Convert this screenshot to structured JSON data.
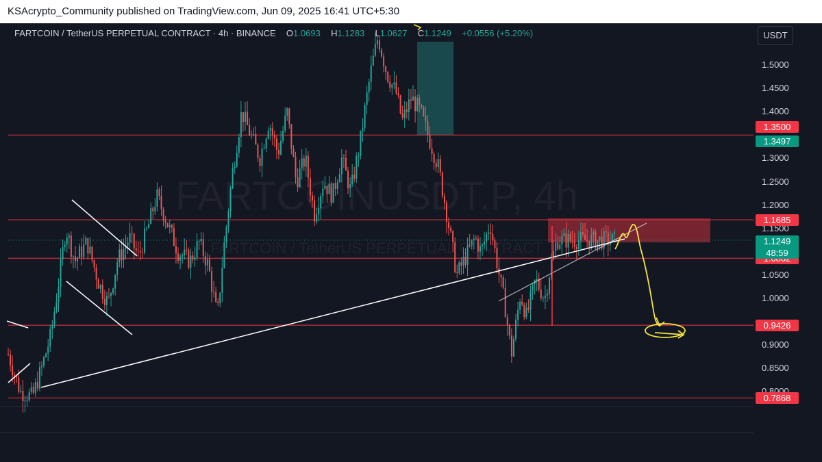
{
  "publisher_line": "KSAcrypto_Community published on TradingView.com, Jun 09, 2025 16:41 UTC+5:30",
  "header": {
    "symbol_line": "FARTCOIN / TetherUS PERPETUAL CONTRACT · 4h · BINANCE",
    "o_label": "O",
    "o_value": "1.0693",
    "h_label": "H",
    "h_value": "1.1283",
    "l_label": "L",
    "l_value": "1.0627",
    "c_label": "C",
    "c_value": "1.1249",
    "change": "+0.0556 (+5.20%)"
  },
  "currency_button": "USDT",
  "watermark": {
    "line1": "FARTCOINUSDT.P, 4h",
    "line2": "FARTCOIN / TetherUS PERPETUAL CONTRACT"
  },
  "colors": {
    "background": "#131722",
    "up": "#26a69a",
    "down": "#ef5350",
    "level_line": "#f23645",
    "badge_red": "#f23645",
    "badge_green": "#089981",
    "trendline": "#ffffff",
    "annotation": "#f5e642"
  },
  "chart_data": {
    "type": "candlestick",
    "timeframe": "4h",
    "y_axis_ticks": [
      "1.5000",
      "1.4500",
      "1.4000",
      "1.3000",
      "1.2500",
      "1.2000",
      "1.1500",
      "1.0500",
      "1.0000",
      "0.9000",
      "0.8500",
      "0.8000"
    ],
    "ylim": [
      0.77,
      1.55
    ],
    "horizontal_levels": [
      {
        "price": 1.3497,
        "label": "1.3497",
        "badge": "green"
      },
      {
        "price": 1.35,
        "label": "1.3500",
        "badge": "red"
      },
      {
        "price": 1.1685,
        "label": "1.1685",
        "badge": "red"
      },
      {
        "price": 1.0862,
        "label": "1.0862",
        "badge": "red"
      },
      {
        "price": 0.9426,
        "label": "0.9426",
        "badge": "red"
      },
      {
        "price": 0.7868,
        "label": "0.7868",
        "badge": "red"
      }
    ],
    "current_price": {
      "value": "1.1249",
      "countdown": "48:59"
    },
    "resistance_zone": {
      "from": 1.1685,
      "to": 1.12
    },
    "profit_zone": {
      "from": 1.35,
      "to": 1.55
    },
    "ohlc_last": {
      "open": 1.0693,
      "high": 1.1283,
      "low": 1.0627,
      "close": 1.1249,
      "change": 0.0556,
      "change_pct": 5.2
    },
    "close_path": [
      [
        0,
        0.88
      ],
      [
        0.02,
        0.8
      ],
      [
        0.04,
        0.79
      ],
      [
        0.055,
        0.85
      ],
      [
        0.07,
        0.92
      ],
      [
        0.085,
        1.05
      ],
      [
        0.095,
        1.15
      ],
      [
        0.11,
        1.08
      ],
      [
        0.13,
        1.12
      ],
      [
        0.15,
        1.03
      ],
      [
        0.165,
        0.99
      ],
      [
        0.18,
        1.08
      ],
      [
        0.2,
        1.13
      ],
      [
        0.215,
        1.09
      ],
      [
        0.23,
        1.15
      ],
      [
        0.245,
        1.22
      ],
      [
        0.26,
        1.17
      ],
      [
        0.28,
        1.1
      ],
      [
        0.3,
        1.08
      ],
      [
        0.315,
        1.12
      ],
      [
        0.33,
        1.07
      ],
      [
        0.345,
        0.96
      ],
      [
        0.355,
        1.1
      ],
      [
        0.37,
        1.27
      ],
      [
        0.385,
        1.4
      ],
      [
        0.4,
        1.35
      ],
      [
        0.415,
        1.3
      ],
      [
        0.43,
        1.38
      ],
      [
        0.445,
        1.31
      ],
      [
        0.46,
        1.4
      ],
      [
        0.475,
        1.25
      ],
      [
        0.49,
        1.3
      ],
      [
        0.505,
        1.18
      ],
      [
        0.52,
        1.25
      ],
      [
        0.535,
        1.22
      ],
      [
        0.55,
        1.3
      ],
      [
        0.565,
        1.23
      ],
      [
        0.58,
        1.33
      ],
      [
        0.59,
        1.42
      ],
      [
        0.6,
        1.5
      ],
      [
        0.61,
        1.56
      ],
      [
        0.625,
        1.48
      ],
      [
        0.64,
        1.44
      ],
      [
        0.65,
        1.38
      ],
      [
        0.665,
        1.43
      ],
      [
        0.68,
        1.4
      ],
      [
        0.695,
        1.34
      ],
      [
        0.71,
        1.28
      ],
      [
        0.725,
        1.17
      ],
      [
        0.74,
        1.05
      ],
      [
        0.755,
        1.09
      ],
      [
        0.77,
        1.13
      ],
      [
        0.78,
        1.1
      ],
      [
        0.795,
        1.16
      ],
      [
        0.81,
        1.05
      ],
      [
        0.82,
        0.98
      ],
      [
        0.83,
        0.88
      ],
      [
        0.845,
        1.01
      ],
      [
        0.855,
        0.96
      ],
      [
        0.87,
        1.04
      ],
      [
        0.885,
        1.0
      ],
      [
        0.895,
        1.07
      ],
      [
        0.905,
        1.1249
      ]
    ]
  }
}
